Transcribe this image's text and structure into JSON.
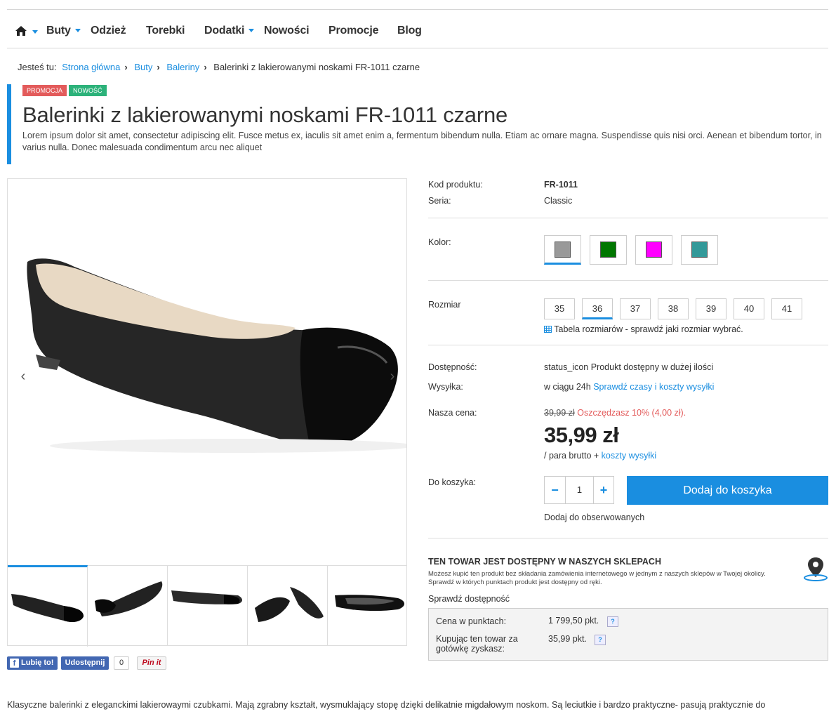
{
  "nav": {
    "items": [
      {
        "label": "Buty"
      },
      {
        "label": "Odzież"
      },
      {
        "label": "Torebki"
      },
      {
        "label": "Dodatki"
      },
      {
        "label": "Nowości"
      },
      {
        "label": "Promocje"
      },
      {
        "label": "Blog"
      }
    ]
  },
  "breadcrumb": {
    "prefix": "Jesteś tu:",
    "items": [
      "Strona główna",
      "Buty",
      "Baleriny"
    ],
    "current": "Balerinki z lakierowanymi noskami FR-1011 czarne"
  },
  "badges": {
    "promo": "Promocja",
    "new": "Nowość"
  },
  "product": {
    "title": "Balerinki z lakierowanymi noskami FR-1011 czarne",
    "description": "Lorem ipsum dolor sit amet, consectetur adipiscing elit. Fusce metus ex, iaculis sit amet enim a, fermentum bibendum nulla. Etiam ac ornare magna. Suspendisse quis nisi orci. Aenean et bibendum tortor, in varius nulla. Donec malesuada condimentum arcu nec aliquet",
    "code_label": "Kod produktu:",
    "code": "FR-1011",
    "series_label": "Seria:",
    "series": "Classic",
    "color_label": "Kolor:",
    "colors": [
      "#999999",
      "#007700",
      "#ff00ff",
      "#339999"
    ],
    "size_label": "Rozmiar",
    "sizes": [
      "35",
      "36",
      "37",
      "38",
      "39",
      "40",
      "41"
    ],
    "size_table_link": "Tabela rozmiarów - sprawdź jaki rozmiar wybrać.",
    "availability_label": "Dostępność:",
    "availability_icon": "status_icon",
    "availability": "Produkt dostępny w dużej ilości",
    "shipping_label": "Wysyłka:",
    "shipping": "w ciągu 24h",
    "shipping_link": "Sprawdź czasy i koszty wysyłki",
    "price_label": "Nasza cena:",
    "old_price": "39,99 zł",
    "savings": "Oszczędzasz 10% (4,00 zł).",
    "price": "35,99 zł",
    "price_note": "/ para brutto +",
    "price_note_link": "koszty wysyłki",
    "cart_label": "Do koszyka:",
    "qty_minus": "−",
    "qty": "1",
    "qty_plus": "+",
    "add_to_cart": "Dodaj do koszyka",
    "watch_link": "Dodaj do obserwowanych"
  },
  "stores": {
    "title": "TEN TOWAR JEST DOSTĘPNY W NASZYCH SKLEPACH",
    "text": "Możesz kupić ten produkt bez składania zamówienia internetowego w jednym z naszych sklepów w Twojej okolicy. Sprawdź w których punktach produkt jest dostępny od ręki.",
    "link": "Sprawdź dostępność"
  },
  "points": {
    "price_label": "Cena w punktach:",
    "price_value": "1 799,50 pkt.",
    "earn_label": "Kupując ten towar za gotówkę zyskasz:",
    "earn_value": "35,99 pkt.",
    "help": "?"
  },
  "social": {
    "like": "Lubię to!",
    "share": "Udostępnij",
    "share_count": "0",
    "pin": "Pin it"
  },
  "gallery": {
    "prev": "‹",
    "next": "›"
  },
  "footer_text": "Klasyczne balerinki z eleganckimi lakierowaymi czubkami. Mają zgrabny kształt, wysmuklający stopę dzięki delikatnie migdałowym noskom. Są leciutkie i bardzo praktyczne- pasują praktycznie do"
}
